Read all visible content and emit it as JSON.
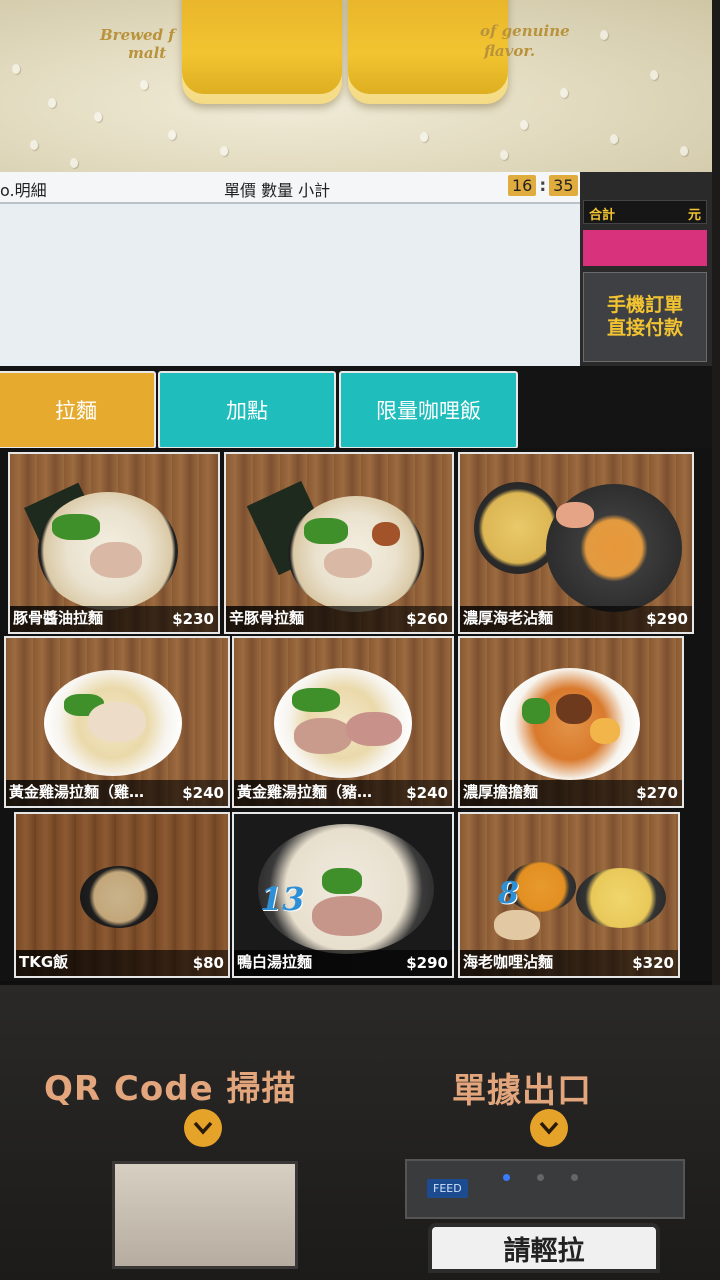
{
  "advert": {
    "text_left": "Brewed f",
    "text_right": "of genuine",
    "text_left2": "malt",
    "text_right2": "flavor."
  },
  "order_panel": {
    "detail_label": "o.明細",
    "columns_label": "單價 數量 小計",
    "clock_hour": "16",
    "clock_sep": ":",
    "clock_minute": "35"
  },
  "side_panel": {
    "total_label": "合計",
    "total_unit": "元",
    "mobile_line1": "手機訂單",
    "mobile_line2": "直接付款"
  },
  "tabs": [
    {
      "label": "拉麵"
    },
    {
      "label": "加點"
    },
    {
      "label": "限量咖哩飯"
    }
  ],
  "menu_items": [
    {
      "name": "豚骨醬油拉麵",
      "price": "$230"
    },
    {
      "name": "辛豚骨拉麵",
      "price": "$260"
    },
    {
      "name": "濃厚海老沾麵",
      "price": "$290"
    },
    {
      "name": "黃金雞湯拉麵（雞…",
      "price": "$240"
    },
    {
      "name": "黃金雞湯拉麵（豬…",
      "price": "$240"
    },
    {
      "name": "濃厚擔擔麵",
      "price": "$270"
    },
    {
      "name": "TKG飯",
      "price": "$80"
    },
    {
      "name": "鴨白湯拉麵",
      "price": "$290",
      "badge": "13"
    },
    {
      "name": "海老咖哩沾麵",
      "price": "$320",
      "badge": "8"
    }
  ],
  "kiosk": {
    "qr_label": "QR Code 掃描",
    "receipt_label": "單據出口",
    "feed_label": "FEED",
    "pull_label": "請輕拉"
  },
  "colors": {
    "active_tab": "#e5aa2e",
    "teal_tab": "#1fbdbb",
    "accent_yellow": "#f3c431",
    "pink_bar": "#d8327d"
  }
}
